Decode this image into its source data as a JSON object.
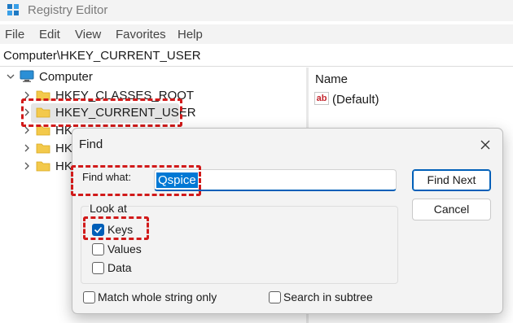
{
  "window": {
    "title": "Registry Editor",
    "icon": "registry-editor-icon"
  },
  "menu": [
    "File",
    "Edit",
    "View",
    "Favorites",
    "Help"
  ],
  "address": {
    "path": "Computer\\HKEY_CURRENT_USER"
  },
  "tree": {
    "root": "Computer",
    "items": [
      "HKEY_CLASSES_ROOT",
      "HKEY_CURRENT_USER",
      "HK",
      "HK",
      "HK"
    ],
    "selected_index": 1
  },
  "values_pane": {
    "column_header": "Name",
    "rows": [
      {
        "name": "(Default)",
        "icon": "string-value-icon"
      }
    ]
  },
  "find_dialog": {
    "title": "Find",
    "find_what_label": "Find what:",
    "find_what_value": "Qspice",
    "find_next_label": "Find Next",
    "cancel_label": "Cancel",
    "look_at_label": "Look at",
    "options": [
      {
        "label": "Keys",
        "checked": true
      },
      {
        "label": "Values",
        "checked": false
      },
      {
        "label": "Data",
        "checked": false
      }
    ],
    "match_whole_label": "Match whole string only",
    "match_whole_checked": false,
    "search_subtree_label": "Search in subtree",
    "search_subtree_checked": false
  },
  "colors": {
    "accent": "#005fb8",
    "highlight": "#d11a1a",
    "folder": "#f3c94b"
  }
}
